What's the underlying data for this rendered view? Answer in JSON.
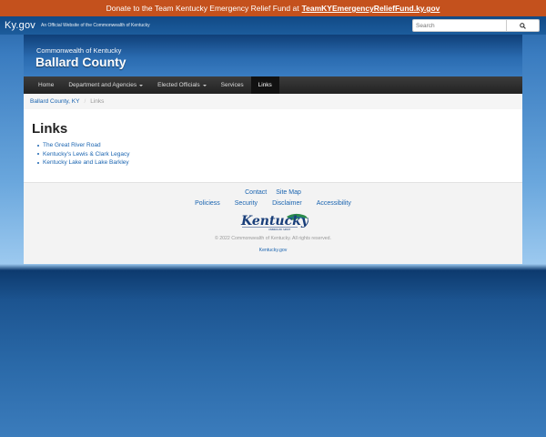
{
  "banner": {
    "text": "Donate to the Team Kentucky Emergency Relief Fund at",
    "link": "TeamKYEmergencyReliefFund.ky.gov"
  },
  "kybar": {
    "logo": "Ky.gov",
    "official": "An Official Website of the Commonwealth of Kentucky",
    "search_placeholder": "Search"
  },
  "header": {
    "subtitle": "Commonwealth of Kentucky",
    "title": "Ballard County"
  },
  "nav": {
    "items": [
      {
        "label": "Home"
      },
      {
        "label": "Department and Agencies"
      },
      {
        "label": "Elected Officials"
      },
      {
        "label": "Services"
      },
      {
        "label": "Links"
      }
    ]
  },
  "breadcrumb": {
    "home": "Ballard County, KY",
    "sep": "/",
    "current": "Links"
  },
  "content": {
    "heading": "Links",
    "links": [
      "The Great River Road",
      "Kentucky's Lewis & Clark Legacy",
      "Kentucky Lake and Lake Barkley"
    ]
  },
  "footer": {
    "row1": [
      "Contact",
      "Site Map"
    ],
    "row2": [
      "Policiess",
      "Security",
      "Disclaimer",
      "Accessibility"
    ],
    "logo_text": "Kentucky",
    "logo_tagline": "UNBRIDLED SPIRIT",
    "copyright": "© 2022 Commonwealth of Kentucky. All rights reserved.",
    "kygov": "Kentucky.gov"
  },
  "colors": {
    "banner": "#c4511d",
    "link": "#1a64b0",
    "nav_bg": "#222222"
  }
}
